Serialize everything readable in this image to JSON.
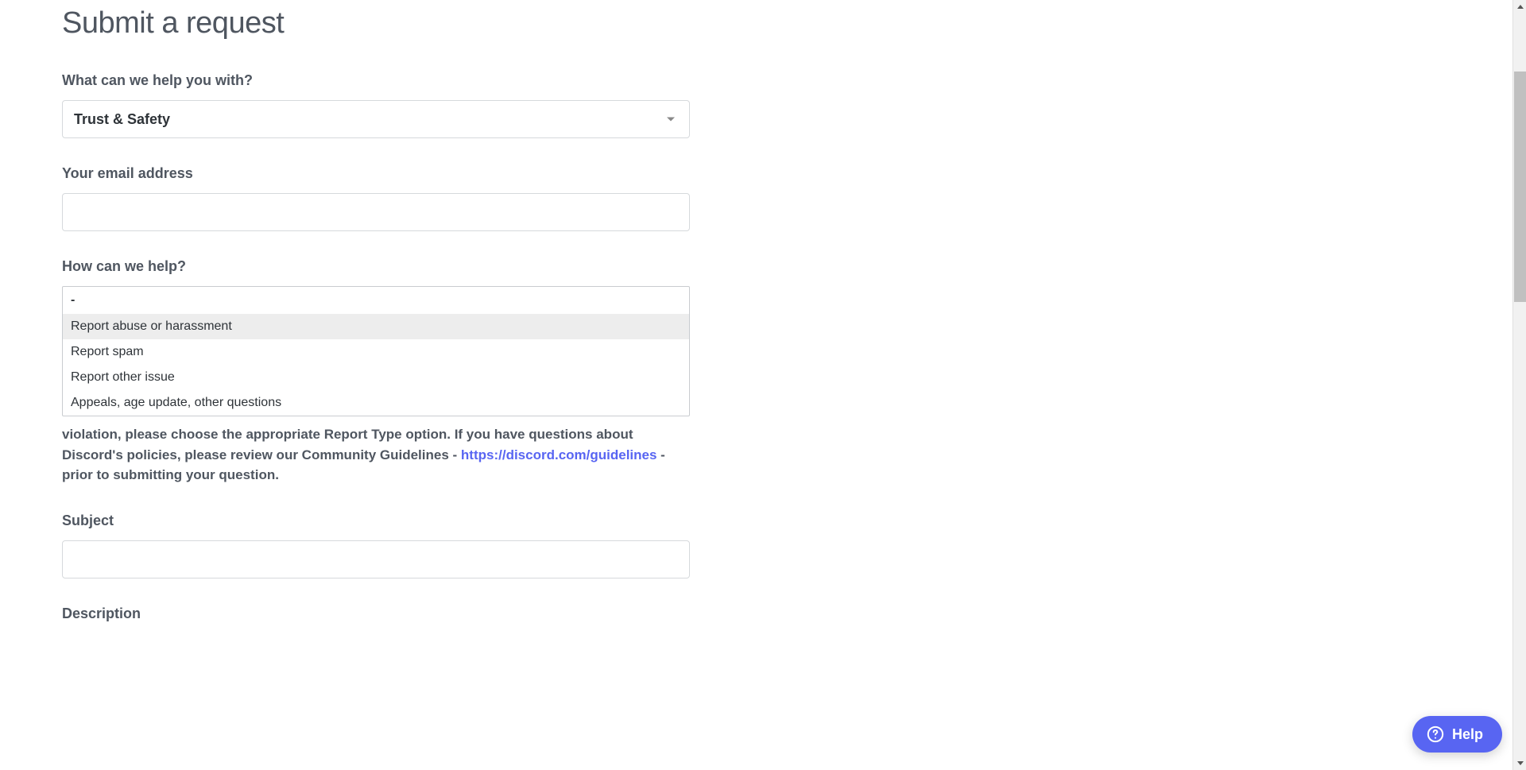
{
  "page": {
    "title": "Submit a request"
  },
  "form": {
    "help_with": {
      "label": "What can we help you with?",
      "selected": "Trust & Safety"
    },
    "email": {
      "label": "Your email address",
      "value": ""
    },
    "how_help": {
      "label": "How can we help?",
      "placeholder": "-",
      "options": [
        "Report abuse or harassment",
        "Report spam",
        "Report other issue",
        "Appeals, age update, other questions"
      ],
      "highlighted_index": 0
    },
    "hint": {
      "text_before_link": "violation, please choose the appropriate Report Type option. If you have questions about Discord's policies, please review our Community Guidelines - ",
      "link_text": "https://discord.com/guidelines",
      "text_after_link": " - prior to submitting your question."
    },
    "subject": {
      "label": "Subject",
      "value": ""
    },
    "description": {
      "label": "Description"
    }
  },
  "help_widget": {
    "label": "Help"
  }
}
